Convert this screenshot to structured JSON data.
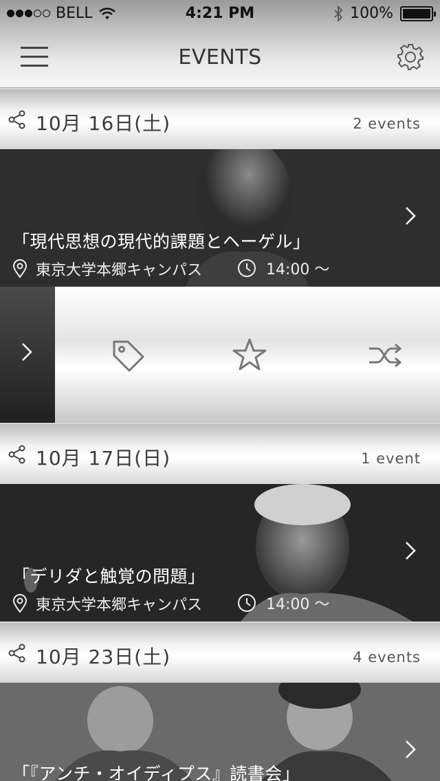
{
  "status_bar": {
    "carrier": "BELL",
    "time": "4:21 PM",
    "battery": "100%",
    "signal_dots_filled": 3,
    "signal_dots_total": 5
  },
  "nav": {
    "title": "EVENTS",
    "menu_icon": "hamburger-menu-icon",
    "settings_icon": "gear-icon"
  },
  "days": [
    {
      "date": "10月 16日(土)",
      "count": "2 events",
      "event": {
        "title": "「現代思想の現代的課題とヘーゲル」",
        "location": "東京大学本郷キャンパス",
        "time": "14:00 〜"
      }
    },
    {
      "date": "10月 17日(日)",
      "count": "1 event",
      "event": {
        "title": "「デリダと触覚の問題」",
        "location": "東京大学本郷キャンパス",
        "time": "14:00 〜"
      }
    },
    {
      "date": "10月 23日(土)",
      "count": "4 events",
      "event": {
        "title": "「『アンチ・オイディプス』読書会」"
      }
    }
  ],
  "actions": {
    "items": [
      "tag-icon",
      "star-icon",
      "shuffle-icon"
    ]
  },
  "colors": {
    "card_dark": "#242424",
    "header_light": "#f2f2f2",
    "icon_gray": "#777777"
  }
}
